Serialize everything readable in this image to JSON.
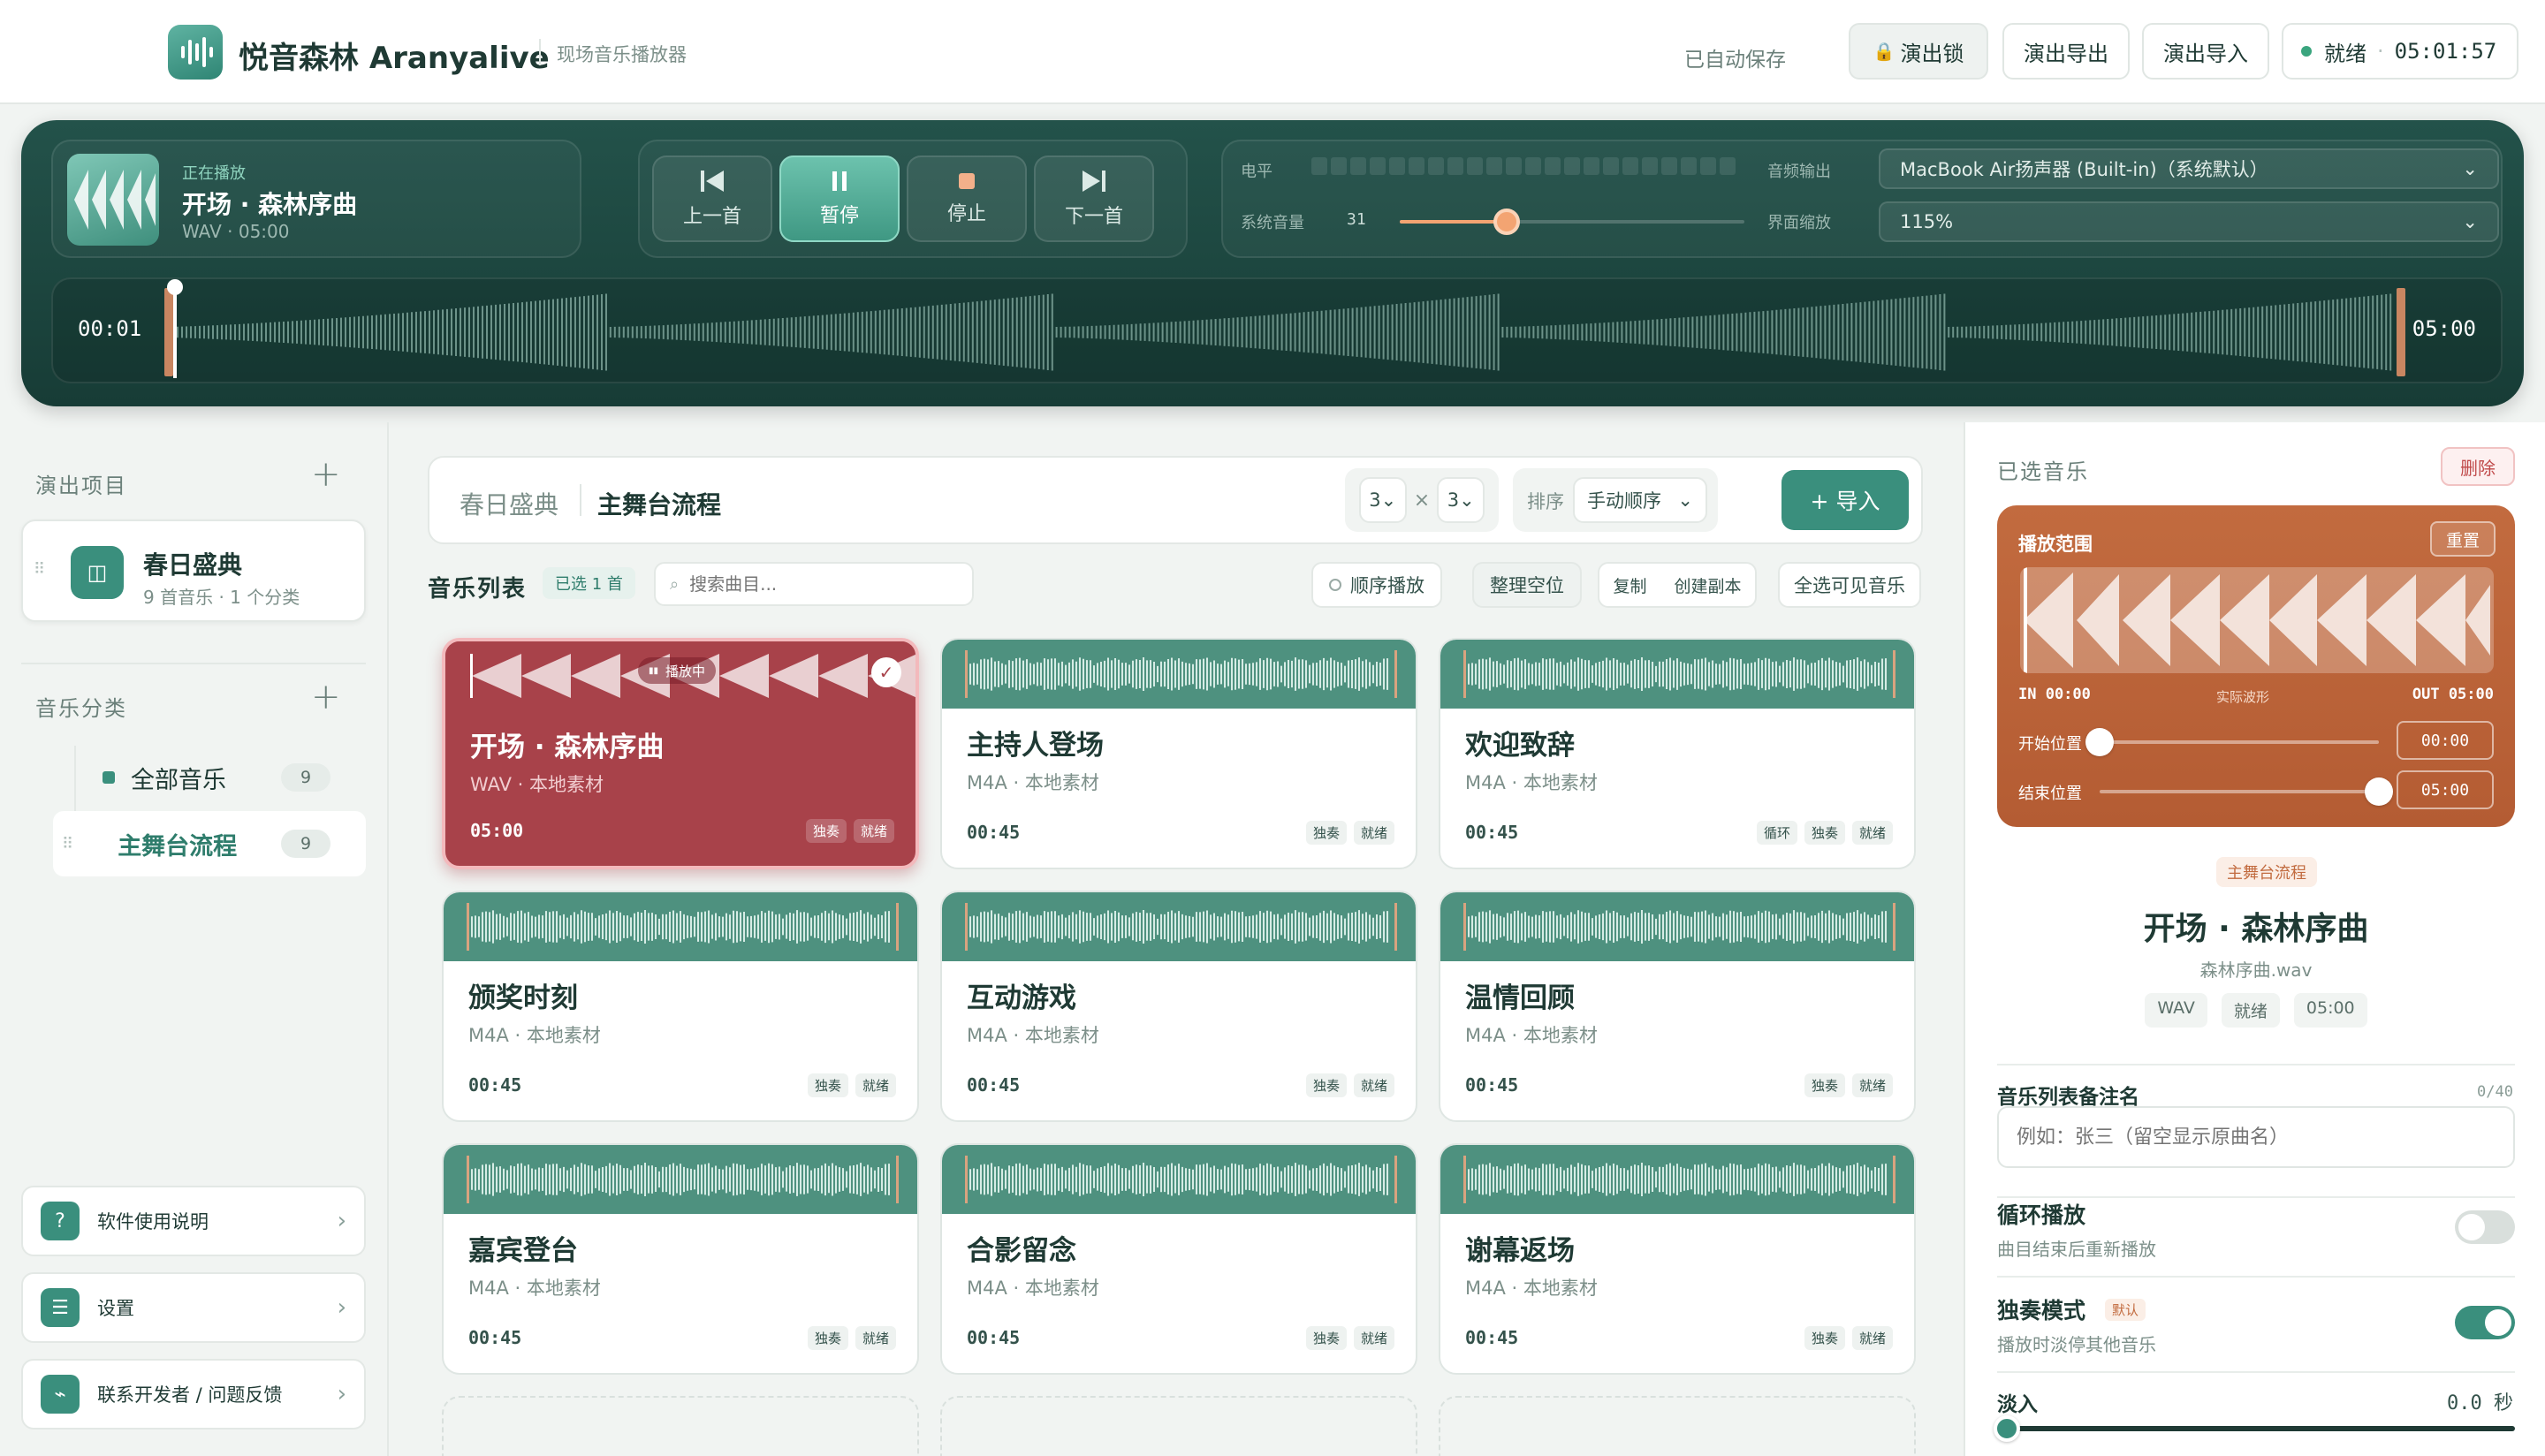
{
  "app": {
    "name": "悦音森林 Aranyalive",
    "subtitle": "现场音乐播放器"
  },
  "topbar": {
    "autosave": "已自动保存",
    "lock": "演出锁",
    "export": "演出导出",
    "import": "演出导入",
    "status": "就绪",
    "clock": "05:01:57"
  },
  "player": {
    "now_label": "正在播放",
    "title": "开场 · 森林序曲",
    "meta": "WAV · 05:00",
    "prev": "上一首",
    "pause": "暂停",
    "stop": "停止",
    "next": "下一首",
    "level_label": "电平",
    "volume_label": "系统音量",
    "volume_value": "31",
    "volume_fraction": 0.31,
    "output_label": "音频输出",
    "output_value": "MacBook Air扬声器 (Built-in)（系统默认）",
    "zoom_label": "界面缩放",
    "zoom_value": "115%",
    "elapsed": "00:01",
    "total": "05:00",
    "progress_fraction": 0.003
  },
  "sidebar": {
    "projects_title": "演出项目",
    "project": {
      "name": "春日盛典",
      "meta": "9 首音乐 · 1 个分类"
    },
    "categories_title": "音乐分类",
    "categories": [
      {
        "label": "全部音乐",
        "count": "9"
      },
      {
        "label": "主舞台流程",
        "count": "9"
      }
    ],
    "help": "软件使用说明",
    "settings": "设置",
    "contact": "联系开发者 / 问题反馈"
  },
  "main": {
    "crumb_project": "春日盛典",
    "crumb_category": "主舞台流程",
    "grid_cols": "3",
    "grid_x": "×",
    "grid_rows": "3",
    "sort_label": "排序",
    "sort_value": "手动顺序",
    "import": "+ 导入",
    "list_title": "音乐列表",
    "selected": "已选 1 首",
    "search_placeholder": "搜索曲目...",
    "seq": "顺序播放",
    "tidy": "整理空位",
    "copy": "复制",
    "dup": "创建副本",
    "selectall": "全选可见音乐",
    "cards": [
      {
        "title": "开场 · 森林序曲",
        "sub": "WAV · 本地素材",
        "dur": "05:00",
        "tags": [
          "独奏",
          "就绪"
        ],
        "active": true,
        "badge": "播放中"
      },
      {
        "title": "主持人登场",
        "sub": "M4A · 本地素材",
        "dur": "00:45",
        "tags": [
          "独奏",
          "就绪"
        ]
      },
      {
        "title": "欢迎致辞",
        "sub": "M4A · 本地素材",
        "dur": "00:45",
        "tags": [
          "循环",
          "独奏",
          "就绪"
        ]
      },
      {
        "title": "颁奖时刻",
        "sub": "M4A · 本地素材",
        "dur": "00:45",
        "tags": [
          "独奏",
          "就绪"
        ]
      },
      {
        "title": "互动游戏",
        "sub": "M4A · 本地素材",
        "dur": "00:45",
        "tags": [
          "独奏",
          "就绪"
        ]
      },
      {
        "title": "温情回顾",
        "sub": "M4A · 本地素材",
        "dur": "00:45",
        "tags": [
          "独奏",
          "就绪"
        ]
      },
      {
        "title": "嘉宾登台",
        "sub": "M4A · 本地素材",
        "dur": "00:45",
        "tags": [
          "独奏",
          "就绪"
        ]
      },
      {
        "title": "合影留念",
        "sub": "M4A · 本地素材",
        "dur": "00:45",
        "tags": [
          "独奏",
          "就绪"
        ]
      },
      {
        "title": "谢幕返场",
        "sub": "M4A · 本地素材",
        "dur": "00:45",
        "tags": [
          "独奏",
          "就绪"
        ]
      }
    ]
  },
  "right": {
    "title": "已选音乐",
    "delete": "删除",
    "range_title": "播放范围",
    "reset": "重置",
    "in_label": "IN 00:00",
    "wave_label": "实际波形",
    "out_label": "OUT 05:00",
    "start_label": "开始位置",
    "start_value": "00:00",
    "start_fraction": 0,
    "end_label": "结束位置",
    "end_value": "05:00",
    "end_fraction": 1,
    "category": "主舞台流程",
    "song": "开场 · 森林序曲",
    "file": "森林序曲.wav",
    "pills": [
      "WAV",
      "就绪",
      "05:00"
    ],
    "note_label": "音乐列表备注名",
    "note_count": "0/40",
    "note_placeholder": "例如：张三（留空显示原曲名）",
    "loop_label": "循环播放",
    "loop_desc": "曲目结束后重新播放",
    "loop_on": false,
    "solo_label": "独奏模式",
    "solo_badge": "默认",
    "solo_desc": "播放时淡停其他音乐",
    "solo_on": true,
    "fadein_label": "淡入",
    "fadein_value": "0.0 秒"
  },
  "colors": {
    "accent": "#3a8f7d",
    "player_bg": "#1d4640",
    "active_card": "#a8424a",
    "range_panel": "#c0673c"
  }
}
